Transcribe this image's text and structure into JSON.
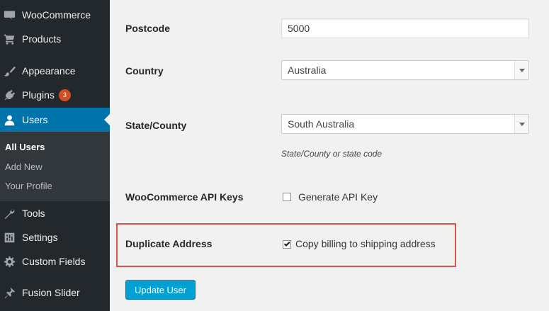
{
  "sidebar": {
    "items": [
      {
        "label": "WooCommerce",
        "icon": "woocommerce-icon"
      },
      {
        "label": "Products",
        "icon": "cart-icon"
      },
      {
        "label": "Appearance",
        "icon": "paintbrush-icon"
      },
      {
        "label": "Plugins",
        "icon": "plug-icon",
        "badge": "3"
      },
      {
        "label": "Users",
        "icon": "user-icon",
        "active": true
      },
      {
        "label": "Tools",
        "icon": "wrench-icon"
      },
      {
        "label": "Settings",
        "icon": "sliders-icon"
      },
      {
        "label": "Custom Fields",
        "icon": "gear-icon"
      },
      {
        "label": "Fusion Slider",
        "icon": "pin-icon"
      }
    ],
    "submenu": [
      {
        "label": "All Users",
        "current": true
      },
      {
        "label": "Add New"
      },
      {
        "label": "Your Profile"
      }
    ]
  },
  "form": {
    "postcode": {
      "label": "Postcode",
      "value": "5000"
    },
    "country": {
      "label": "Country",
      "value": "Australia"
    },
    "state": {
      "label": "State/County",
      "value": "South Australia",
      "hint": "State/County or state code"
    },
    "api_keys": {
      "label": "WooCommerce API Keys",
      "checkbox_label": "Generate API Key",
      "checked": false
    },
    "duplicate": {
      "label": "Duplicate Address",
      "checkbox_label": "Copy billing to shipping address",
      "checked": true
    },
    "submit_label": "Update User"
  },
  "colors": {
    "sidebar_bg": "#23282d",
    "active_bg": "#0073aa",
    "button_bg": "#00a0d2",
    "highlight_border": "#d9534f",
    "badge_bg": "#d54e21"
  }
}
